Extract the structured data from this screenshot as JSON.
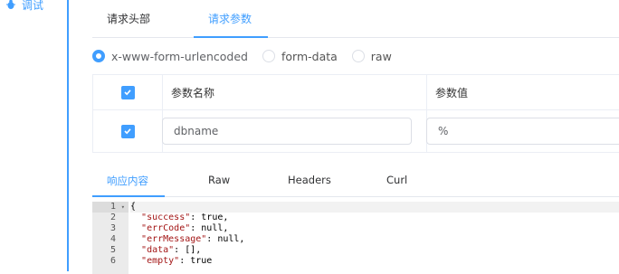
{
  "sidebar": {
    "item_label": "调试"
  },
  "request_tabs": [
    {
      "label": "请求头部",
      "active": false
    },
    {
      "label": "请求参数",
      "active": true
    }
  ],
  "body_types": [
    {
      "label": "x-www-form-urlencoded",
      "checked": true
    },
    {
      "label": "form-data",
      "checked": false
    },
    {
      "label": "raw",
      "checked": false
    }
  ],
  "params_table": {
    "headers": [
      "参数名称",
      "参数值"
    ],
    "rows": [
      {
        "checked": true,
        "name": "dbname",
        "value": "%"
      }
    ]
  },
  "response_tabs": [
    {
      "label": "响应内容",
      "active": true
    },
    {
      "label": "Raw",
      "active": false
    },
    {
      "label": "Headers",
      "active": false
    },
    {
      "label": "Curl",
      "active": false
    }
  ],
  "editor": {
    "lines": [
      {
        "num": "1",
        "text": "{"
      },
      {
        "num": "2",
        "key": "\"success\"",
        "rest": ": true,"
      },
      {
        "num": "3",
        "key": "\"errCode\"",
        "rest": ": null,"
      },
      {
        "num": "4",
        "key": "\"errMessage\"",
        "rest": ": null,"
      },
      {
        "num": "5",
        "key": "\"data\"",
        "rest": ": [],"
      },
      {
        "num": "6",
        "key": "\"empty\"",
        "rest": ": true"
      }
    ]
  },
  "colors": {
    "accent": "#409eff",
    "border": "#ebeef5"
  }
}
